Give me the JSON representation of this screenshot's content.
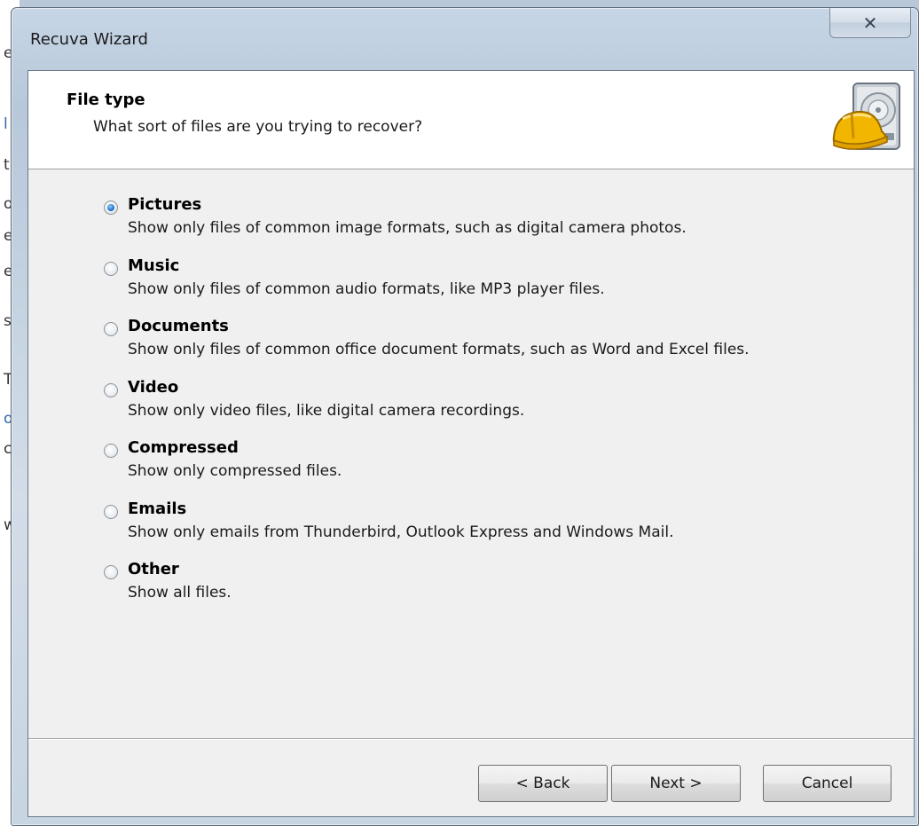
{
  "window": {
    "title": "Recuva Wizard",
    "close_glyph": "✕"
  },
  "background": {
    "chars": [
      "e",
      "l",
      "t",
      "o",
      "e",
      "e",
      "s",
      "T",
      "o",
      "c",
      "w"
    ]
  },
  "header": {
    "title": "File type",
    "subtitle": "What sort of files are you trying to recover?",
    "logo_icon": "recuva-hardhat-drive-icon"
  },
  "options": [
    {
      "label": "Pictures",
      "description": "Show only files of common image formats, such as digital camera photos.",
      "checked": true
    },
    {
      "label": "Music",
      "description": "Show only files of common audio formats, like MP3 player files.",
      "checked": false
    },
    {
      "label": "Documents",
      "description": "Show only files of common office document formats, such as Word and Excel files.",
      "checked": false
    },
    {
      "label": "Video",
      "description": "Show only video files, like digital camera recordings.",
      "checked": false
    },
    {
      "label": "Compressed",
      "description": "Show only compressed files.",
      "checked": false
    },
    {
      "label": "Emails",
      "description": "Show only emails from Thunderbird, Outlook Express and Windows Mail.",
      "checked": false
    },
    {
      "label": "Other",
      "description": "Show all files.",
      "checked": false
    }
  ],
  "buttons": {
    "back": "< Back",
    "next": "Next >",
    "cancel": "Cancel"
  },
  "colors": {
    "accent": "#1f72c8",
    "frame": "#b7c8da",
    "client_bg": "#f0f0f0"
  }
}
